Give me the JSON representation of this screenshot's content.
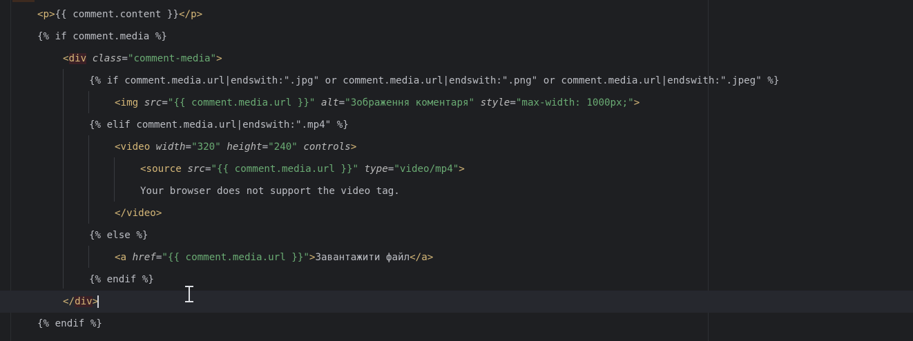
{
  "lines": [
    {
      "id": "l1",
      "parts": [
        [
          "tag",
          "<"
        ],
        [
          "tagname",
          "p"
        ],
        [
          "tag",
          ">"
        ],
        [
          "plain",
          "{{ comment.content }}"
        ],
        [
          "tag",
          "</"
        ],
        [
          "tagname",
          "p"
        ],
        [
          "tag",
          ">"
        ]
      ]
    },
    {
      "id": "l2",
      "parts": [
        [
          "plain",
          "{% if comment.media %}"
        ]
      ]
    },
    {
      "id": "l3",
      "parts": [
        [
          "tag",
          "<"
        ],
        [
          "tagname",
          "div"
        ],
        [
          "attr",
          " class"
        ],
        [
          "plain",
          "="
        ],
        [
          "str",
          "\"comment-media\""
        ],
        [
          "tag",
          ">"
        ]
      ]
    },
    {
      "id": "l4",
      "parts": [
        [
          "plain",
          "{% if comment.media.url|endswith:\".jpg\" or comment.media.url|endswith:\".png\" or comment.media.url|endswith:\".jpeg\" %}"
        ]
      ]
    },
    {
      "id": "l5",
      "parts": [
        [
          "tag",
          "<"
        ],
        [
          "tagname",
          "img"
        ],
        [
          "attr",
          " src"
        ],
        [
          "plain",
          "="
        ],
        [
          "str",
          "\"{{ comment.media.url }}\""
        ],
        [
          "attr",
          " alt"
        ],
        [
          "plain",
          "="
        ],
        [
          "str",
          "\"Зображення коментаря\""
        ],
        [
          "attr",
          " style"
        ],
        [
          "plain",
          "="
        ],
        [
          "str",
          "\"max-width: 1000px;\""
        ],
        [
          "tag",
          ">"
        ]
      ]
    },
    {
      "id": "l6",
      "parts": [
        [
          "plain",
          "{% elif comment.media.url|endswith:\".mp4\" %}"
        ]
      ]
    },
    {
      "id": "l7",
      "parts": [
        [
          "tag",
          "<"
        ],
        [
          "tagname",
          "video"
        ],
        [
          "attr",
          " width"
        ],
        [
          "plain",
          "="
        ],
        [
          "str",
          "\"320\""
        ],
        [
          "attr",
          " height"
        ],
        [
          "plain",
          "="
        ],
        [
          "str",
          "\"240\""
        ],
        [
          "attr",
          " controls"
        ],
        [
          "tag",
          ">"
        ]
      ]
    },
    {
      "id": "l8",
      "parts": [
        [
          "tag",
          "<"
        ],
        [
          "tagname",
          "source"
        ],
        [
          "attr",
          " src"
        ],
        [
          "plain",
          "="
        ],
        [
          "str",
          "\"{{ comment.media.url }}\""
        ],
        [
          "attr",
          " type"
        ],
        [
          "plain",
          "="
        ],
        [
          "str",
          "\"video/mp4\""
        ],
        [
          "tag",
          ">"
        ]
      ]
    },
    {
      "id": "l9",
      "parts": [
        [
          "plain",
          "Your browser does not support the video tag."
        ]
      ]
    },
    {
      "id": "l10",
      "parts": [
        [
          "tag",
          "</"
        ],
        [
          "tagname",
          "video"
        ],
        [
          "tag",
          ">"
        ]
      ]
    },
    {
      "id": "l11",
      "parts": [
        [
          "plain",
          "{% else %}"
        ]
      ]
    },
    {
      "id": "l12",
      "parts": [
        [
          "tag",
          "<"
        ],
        [
          "tagname",
          "a"
        ],
        [
          "attr",
          " href"
        ],
        [
          "plain",
          "="
        ],
        [
          "str",
          "\"{{ comment.media.url }}\""
        ],
        [
          "tag",
          ">"
        ],
        [
          "plain",
          "Завантажити файл"
        ],
        [
          "tag",
          "</"
        ],
        [
          "tagname",
          "a"
        ],
        [
          "tag",
          ">"
        ]
      ]
    },
    {
      "id": "l13",
      "parts": [
        [
          "plain",
          "{% endif %}"
        ]
      ]
    },
    {
      "id": "l14",
      "parts": [
        [
          "tag",
          "</"
        ],
        [
          "tagname",
          "div"
        ],
        [
          "tag",
          ">"
        ]
      ]
    },
    {
      "id": "l15",
      "parts": [
        [
          "plain",
          "{% endif %}"
        ]
      ]
    }
  ]
}
